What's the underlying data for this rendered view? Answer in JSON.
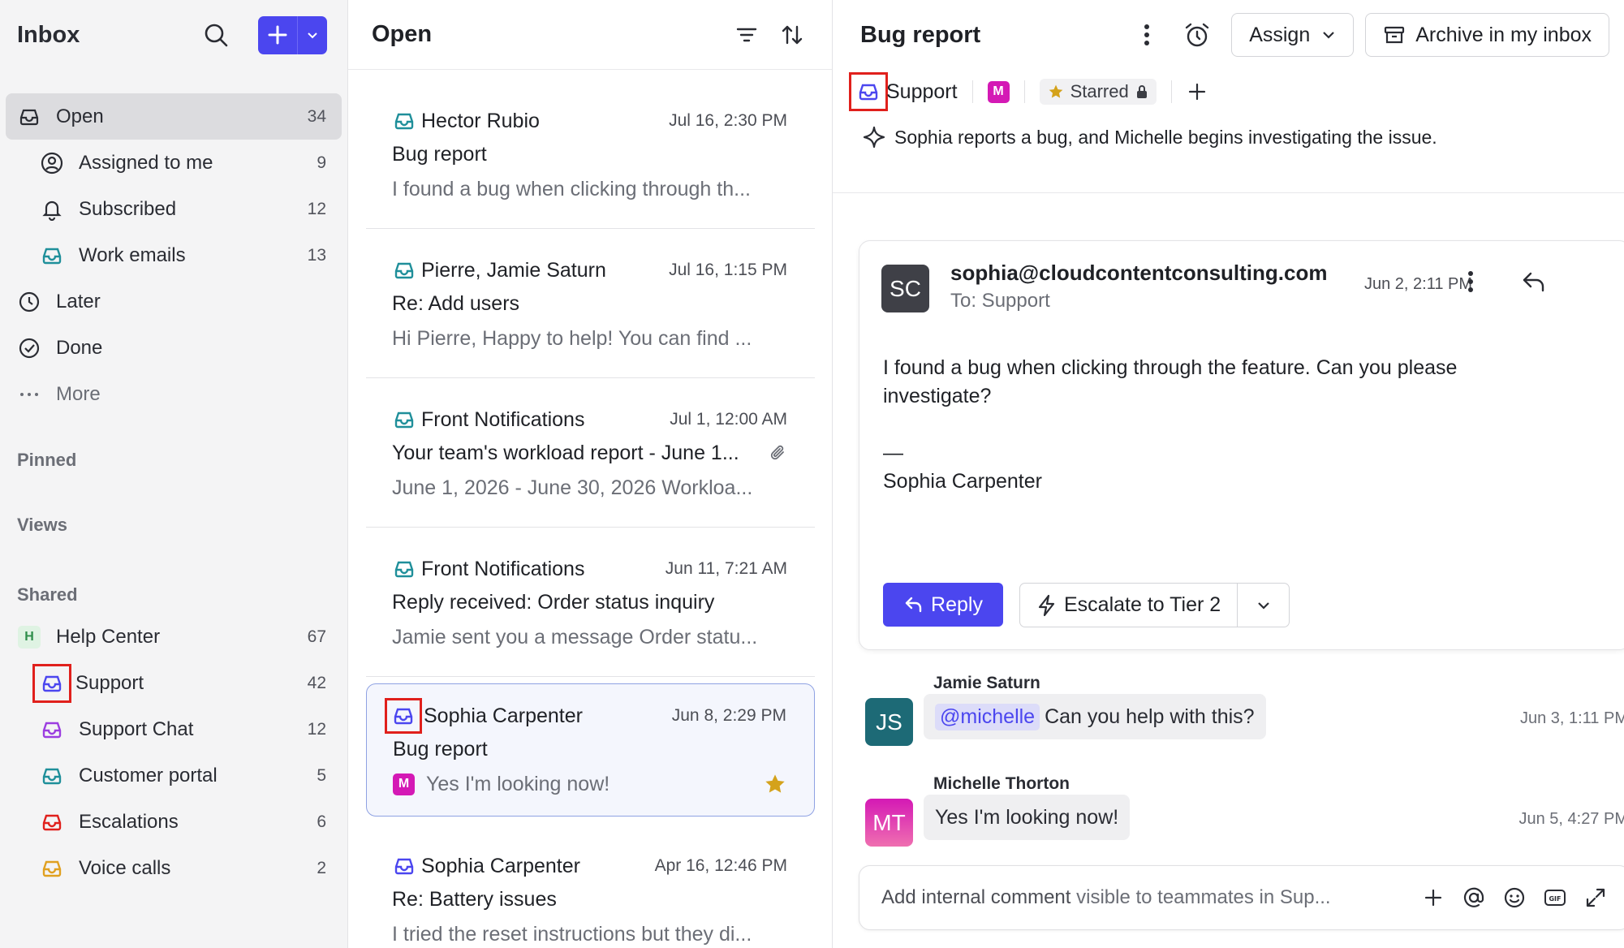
{
  "colors": {
    "accent": "#4b46ef",
    "teal": "#1f8f9a",
    "violet": "#9b3de0",
    "red": "#e0201c",
    "amber": "#e0a020",
    "star": "#d4a21b",
    "magenta": "#d419b5"
  },
  "sidebar": {
    "title": "Inbox",
    "items": [
      {
        "label": "Open",
        "count": "34"
      },
      {
        "label": "Assigned to me",
        "count": "9"
      },
      {
        "label": "Subscribed",
        "count": "12"
      },
      {
        "label": "Work emails",
        "count": "13"
      },
      {
        "label": "Later"
      },
      {
        "label": "Done"
      },
      {
        "label": "More"
      }
    ],
    "sections": {
      "pinned": "Pinned",
      "views": "Views",
      "shared": "Shared"
    },
    "shared": [
      {
        "badge": "H",
        "label": "Help Center",
        "count": "67"
      },
      {
        "label": "Support",
        "count": "42"
      },
      {
        "label": "Support Chat",
        "count": "12"
      },
      {
        "label": "Customer portal",
        "count": "5"
      },
      {
        "label": "Escalations",
        "count": "6"
      },
      {
        "label": "Voice calls",
        "count": "2"
      }
    ]
  },
  "list": {
    "title": "Open",
    "conversations": [
      {
        "from": "Hector Rubio",
        "date": "Jul 16, 2:30 PM",
        "subject": "Bug report",
        "preview": "I found a bug when clicking through th..."
      },
      {
        "from": "Pierre, Jamie Saturn",
        "date": "Jul 16, 1:15 PM",
        "subject": "Re: Add users",
        "preview": "Hi Pierre, Happy to help! You can find ..."
      },
      {
        "from": "Front Notifications",
        "date": "Jul 1, 12:00 AM",
        "subject": "Your team's workload report - June 1...",
        "preview": "June 1, 2026 - June 30, 2026 Workloa..."
      },
      {
        "from": "Front Notifications",
        "date": "Jun 11, 7:21 AM",
        "subject": "Reply received: Order status inquiry",
        "preview": "Jamie sent you a message Order statu..."
      },
      {
        "from": "Sophia Carpenter",
        "date": "Jun 8, 2:29 PM",
        "subject": "Bug report",
        "badge": "M",
        "preview": "Yes I'm looking now!"
      },
      {
        "from": "Sophia Carpenter",
        "date": "Apr 16, 12:46 PM",
        "subject": "Re: Battery issues",
        "preview": "I tried the reset instructions but they di..."
      }
    ]
  },
  "detail": {
    "title": "Bug report",
    "assign_label": "Assign",
    "archive_label": "Archive in my inbox",
    "inbox_tag": "Support",
    "member_badge": "M",
    "starred_label": "Starred",
    "summary": "Sophia reports a bug, and Michelle begins investigating the issue.",
    "message": {
      "avatar": "SC",
      "sender": "sophia@cloudcontentconsulting.com",
      "to": "To: Support",
      "date": "Jun 2, 2:11 PM",
      "body": "I found a bug when clicking through the feature. Can you please investigate?",
      "sig_dash": "—",
      "sig_name": "Sophia Carpenter",
      "reply_label": "Reply",
      "escalate_label": "Escalate to Tier 2"
    },
    "comments": [
      {
        "author": "Jamie Saturn",
        "avatar": "JS",
        "mention": "@michelle",
        "text": "Can you help with this?",
        "date": "Jun 3, 1:11 PM"
      },
      {
        "author": "Michelle Thorton",
        "avatar": "MT",
        "text": "Yes I'm looking now!",
        "date": "Jun 5, 4:27 PM"
      }
    ],
    "composer": {
      "prefix": "Add internal comment",
      "suffix": "visible to teammates in Sup..."
    }
  }
}
